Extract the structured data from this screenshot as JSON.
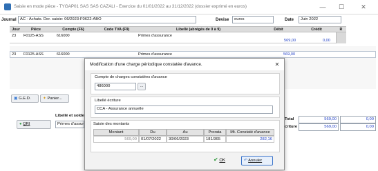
{
  "window": {
    "title": "Saisie en mode pièce - TYGAP01 SAS SAS CAZALI - Exercice du 01/01/2022 au 31/12/2022 (dossier exprimé en euros)",
    "minimize": "—",
    "maximize": "☐",
    "close": "✕"
  },
  "header": {
    "journal_label": "Journal",
    "journal_value": "AC - Achats. Der. saisie: 06/2023-F0622-ABO",
    "devise_label": "Devise",
    "devise_value": "euros",
    "date_label": "Date",
    "date_value": "Juin 2022"
  },
  "grid": {
    "columns": [
      "Jour",
      "Pièce",
      "Compte (F6)",
      "Code TVA (F9)",
      "Libellé (abrégés de 0 à 9)",
      "Débit",
      "Crédit",
      "R"
    ],
    "row1": {
      "jour": "23",
      "piece": "F0125-ASS",
      "compte": "616000",
      "libelle": "Primes d'assurance",
      "debit": "569,00",
      "credit": "0,00"
    },
    "row2": {
      "jour": "23",
      "piece": "F0125-ASS",
      "compte": "616000",
      "libelle": "Primes d'assurance",
      "debit": "569,00"
    }
  },
  "bottom": {
    "ged_label": "G.E.D.",
    "panier_label": "Panier...",
    "libelle_solde_label": "Libellé et solde",
    "qri_label": "QRI",
    "primes_value": "Primes d'assuranc",
    "total_label": "Total",
    "ecriture_label": "criture",
    "total_debit": "569,00",
    "total_credit": "0,00",
    "ecriture_debit": "569,00",
    "ecriture_credit": "0,00"
  },
  "dialog": {
    "title": "Modification d'une charge périodique constatée d'avance.",
    "close": "✕",
    "compte_label": "Compte de charges constatées d'avance",
    "compte_value": "486000",
    "compte_btn": "...",
    "libelle_label": "Libellé écriture",
    "libelle_value": "CCA - Assurance annuelle",
    "saisie_label": "Saisie des montants",
    "table_headers": [
      "Montant",
      "Du",
      "Au",
      "Prorata",
      "Mt. Constaté d'avance"
    ],
    "row": {
      "montant": "569,00",
      "du": "01/07/2022",
      "au": "30/06/2023",
      "prorata": "181/365",
      "constate": "282,16"
    },
    "ok_label": "OK",
    "cancel_label": "Annuler"
  }
}
